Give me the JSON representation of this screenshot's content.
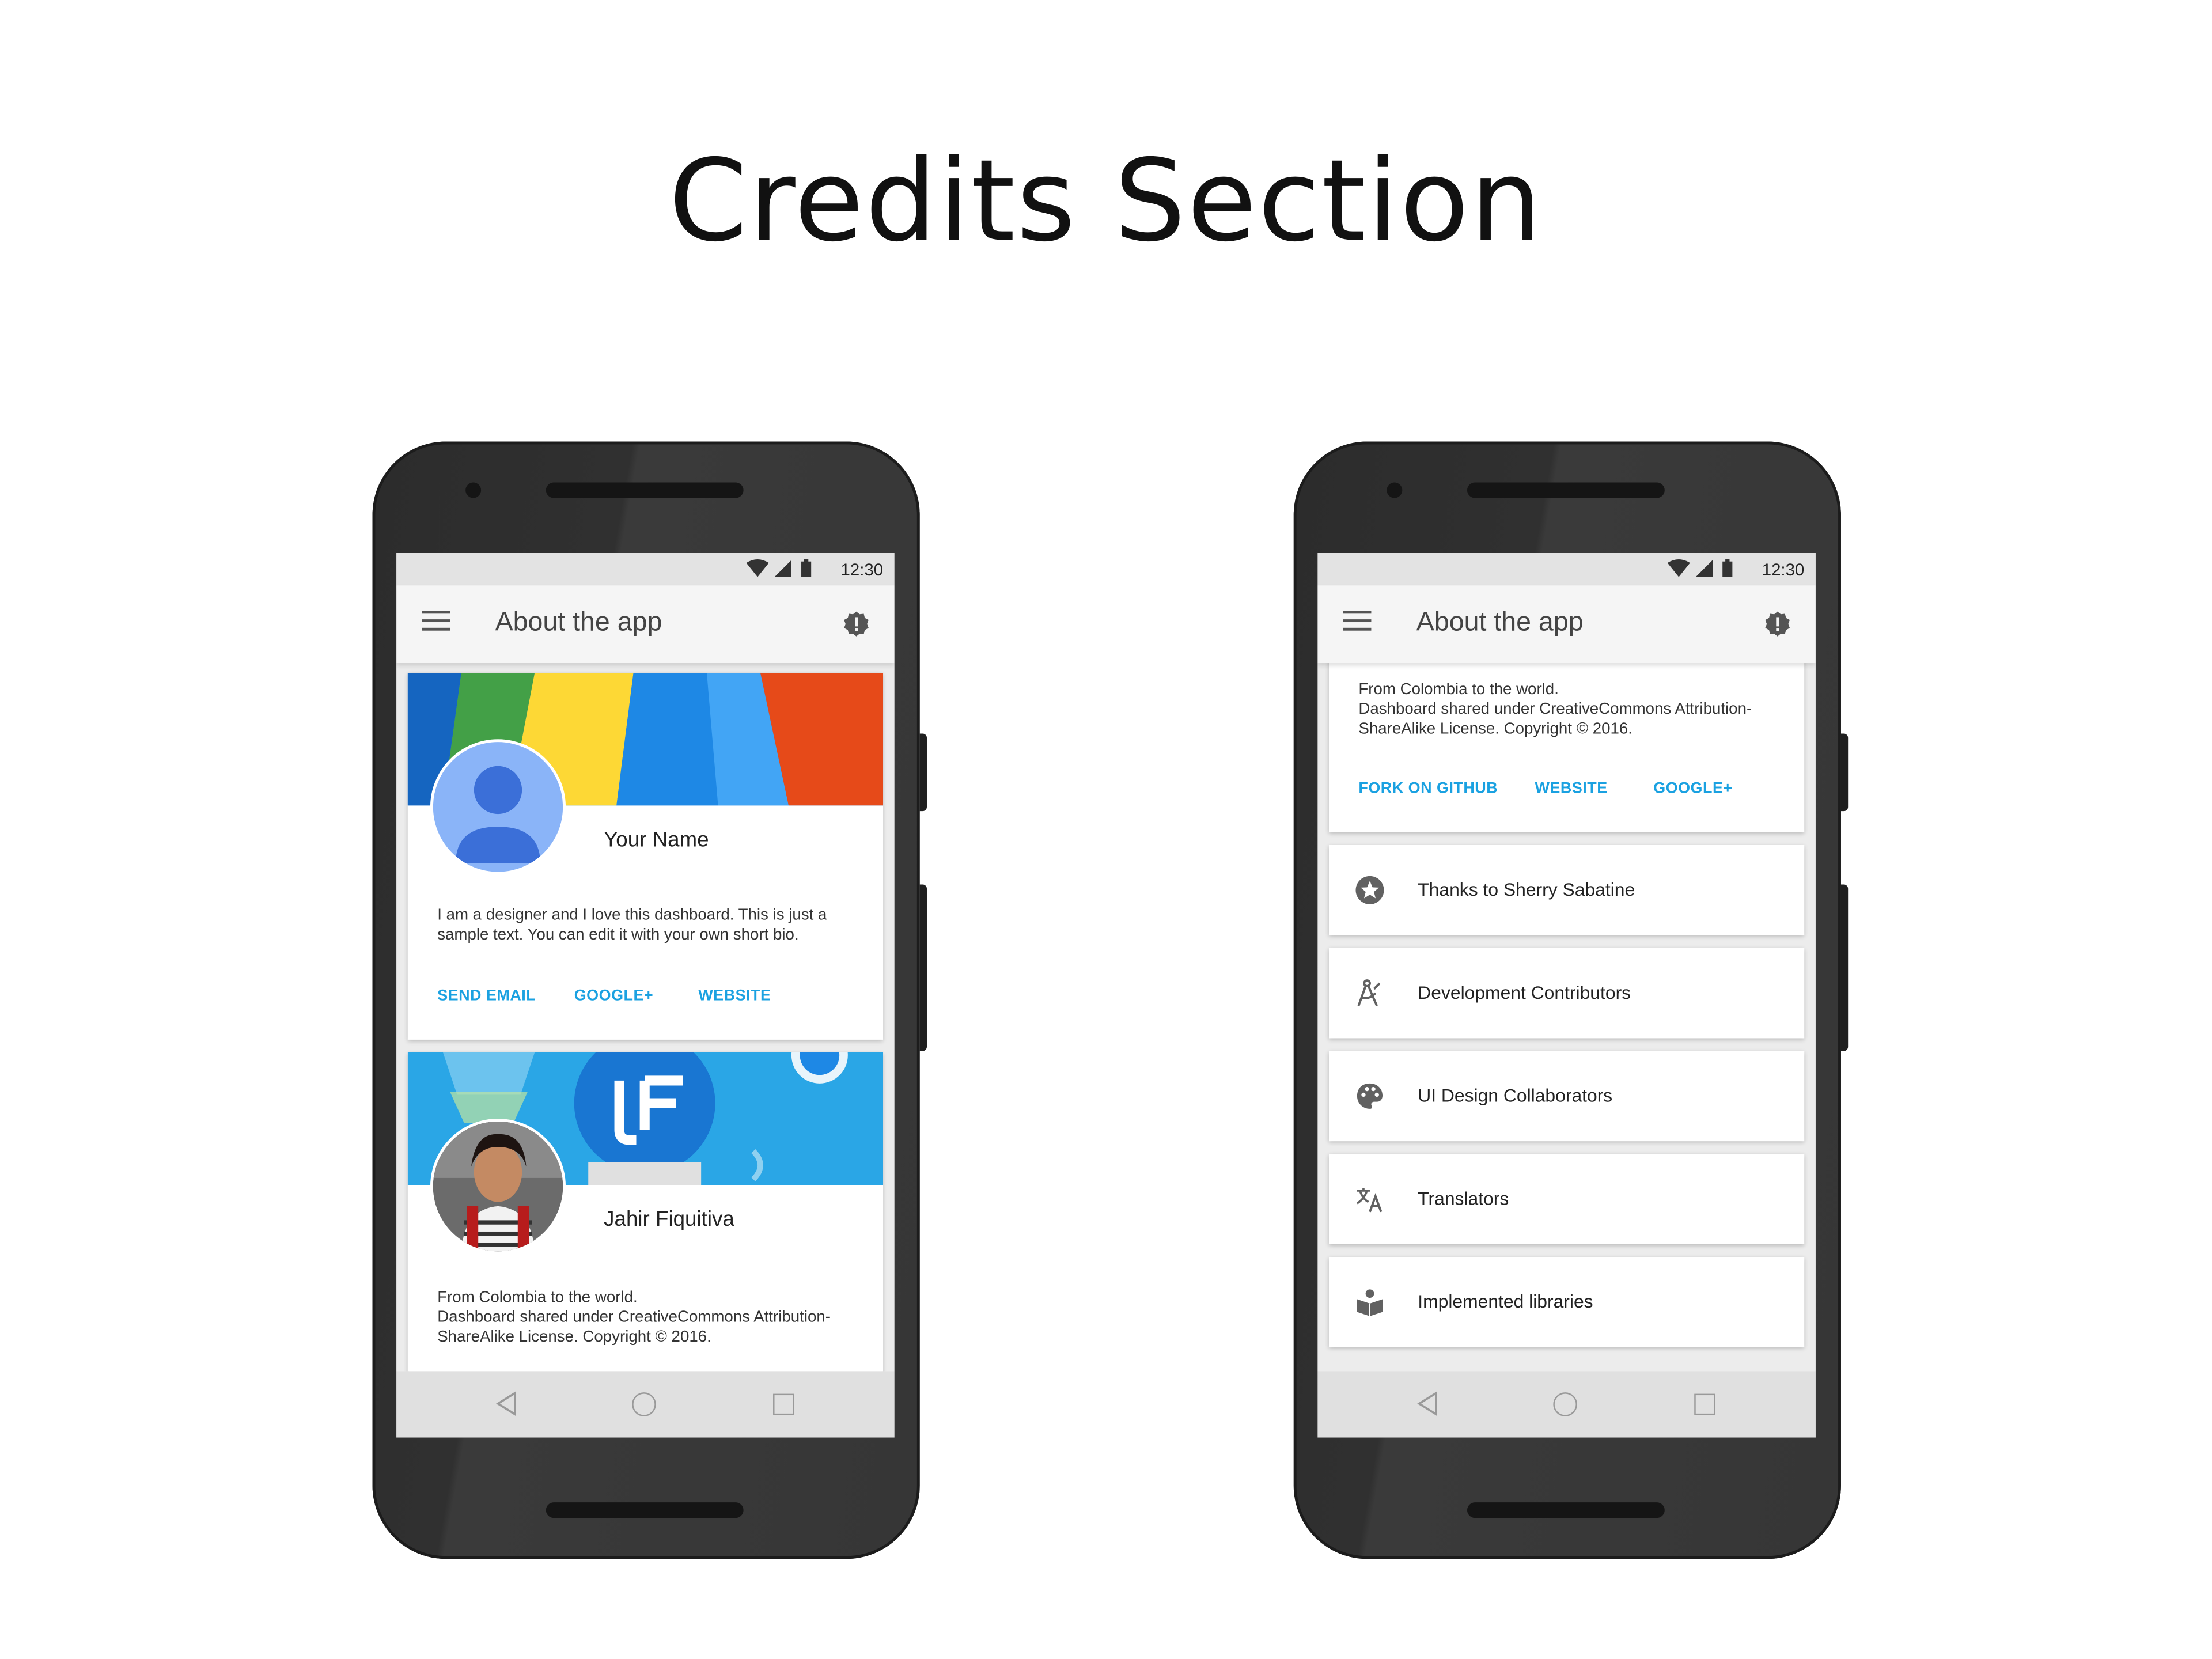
{
  "page": {
    "title": "Credits Section"
  },
  "status_bar": {
    "time": "12:30"
  },
  "app_bar": {
    "title": "About the app"
  },
  "left_screen": {
    "profile_card": {
      "name": "Your Name",
      "bio_lines": [
        "I am a designer and I love this dashboard. This is just a",
        "sample text. You can edit it with your own short bio."
      ],
      "actions": [
        "SEND EMAIL",
        "GOOGLE+",
        "WEBSITE"
      ]
    },
    "author_card": {
      "name": "Jahir Fiquitiva",
      "bio_lines": [
        "From Colombia to the world.",
        "Dashboard shared under CreativeCommons Attribution-",
        "ShareAlike License. Copyright © 2016."
      ]
    }
  },
  "right_screen": {
    "author_card": {
      "bio_lines": [
        "From Colombia to the world.",
        "Dashboard shared under CreativeCommons Attribution-",
        "ShareAlike License. Copyright © 2016."
      ],
      "actions": [
        "FORK ON GITHUB",
        "WEBSITE",
        "GOOGLE+"
      ]
    },
    "list": [
      {
        "icon": "star-circle-icon",
        "label": "Thanks to Sherry Sabatine"
      },
      {
        "icon": "compass-drafting-icon",
        "label": "Development Contributors"
      },
      {
        "icon": "palette-icon",
        "label": "UI Design Collaborators"
      },
      {
        "icon": "translate-icon",
        "label": "Translators"
      },
      {
        "icon": "library-book-icon",
        "label": "Implemented libraries"
      }
    ]
  },
  "colors": {
    "accent": "#1aa1e1",
    "phone_body": "#303030",
    "app_bar": "#f5f5f5",
    "background": "#ececec"
  }
}
